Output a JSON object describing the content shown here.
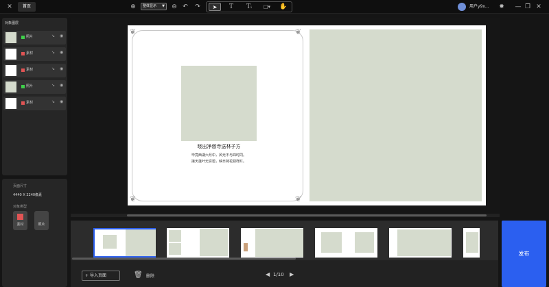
{
  "topbar": {
    "back_icon": "close-icon",
    "home_tab": "首页",
    "fit_select_value": "整体显示",
    "username": "用户y9x...",
    "accent": "#2b5ff0"
  },
  "layers": {
    "title": "对象图层",
    "items": [
      {
        "label": "照片",
        "swatch": "#3fcf4a",
        "thumb": "#d5dbcd"
      },
      {
        "label": "素材",
        "swatch": "#e05454",
        "thumb": "#ffffff"
      },
      {
        "label": "素材",
        "swatch": "#e05454",
        "thumb": "#ffffff"
      },
      {
        "label": "照片",
        "swatch": "#3fcf4a",
        "thumb": "#d5dbcd"
      },
      {
        "label": "素材",
        "swatch": "#e05454",
        "thumb": "#ffffff"
      }
    ]
  },
  "props": {
    "page_size_label": "页面尺寸",
    "page_size_value": "4440 X 2240像素",
    "object_type_label": "对象类型",
    "type_material": "素材",
    "type_photo": "照片"
  },
  "canvas": {
    "poem_title": "晓出净慈寺送林子方",
    "poem_line1": "毕竟西湖六月中，风光不与四时同。",
    "poem_line2": "接天莲叶无穷碧，映日荷花别样红。",
    "photo_color": "#d5dbcd"
  },
  "bottom": {
    "import_label": "导入页面",
    "delete_label": "删除",
    "pager": "1/10",
    "publish": "发布"
  }
}
